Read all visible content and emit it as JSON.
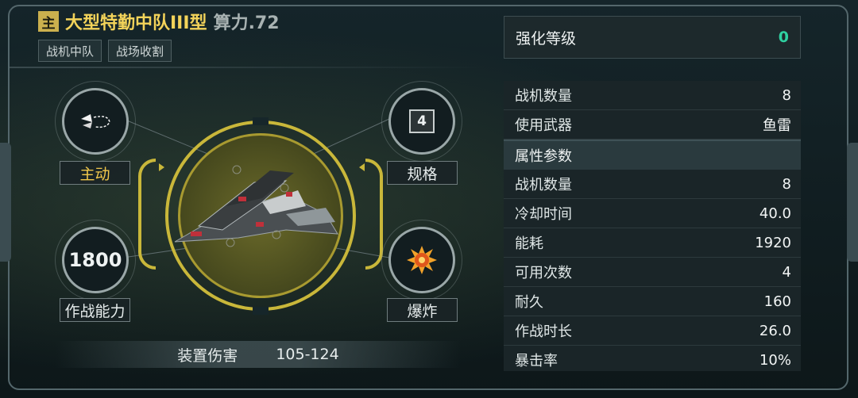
{
  "header": {
    "badge": "主",
    "title": "大型特勤中队III型",
    "power": "算力.72",
    "tags": [
      "战机中队",
      "战场收割"
    ]
  },
  "stats": {
    "active": {
      "label": "主动",
      "icon": "missile-launch-icon"
    },
    "spec": {
      "value": "4",
      "label": "规格"
    },
    "combat": {
      "value": "1800",
      "label": "作战能力"
    },
    "explode": {
      "label": "爆炸",
      "icon": "explosion-icon"
    }
  },
  "damage": {
    "label": "装置伤害",
    "value": "105-124"
  },
  "enhance": {
    "label": "强化等级",
    "value": "0"
  },
  "panel": {
    "top_rows": [
      {
        "k": "战机数量",
        "v": "8"
      },
      {
        "k": "使用武器",
        "v": "鱼雷"
      }
    ],
    "section_title": "属性参数",
    "attr_rows": [
      {
        "k": "战机数量",
        "v": "8"
      },
      {
        "k": "冷却时间",
        "v": "40.0"
      },
      {
        "k": "能耗",
        "v": "1920"
      },
      {
        "k": "可用次数",
        "v": "4"
      },
      {
        "k": "耐久",
        "v": "160"
      },
      {
        "k": "作战时长",
        "v": "26.0"
      },
      {
        "k": "暴击率",
        "v": "10%"
      }
    ]
  },
  "colors": {
    "accent": "#f3d35a",
    "ring": "#c9b73a",
    "enhance": "#2fd1a1",
    "active_label": "#f2c84b"
  }
}
